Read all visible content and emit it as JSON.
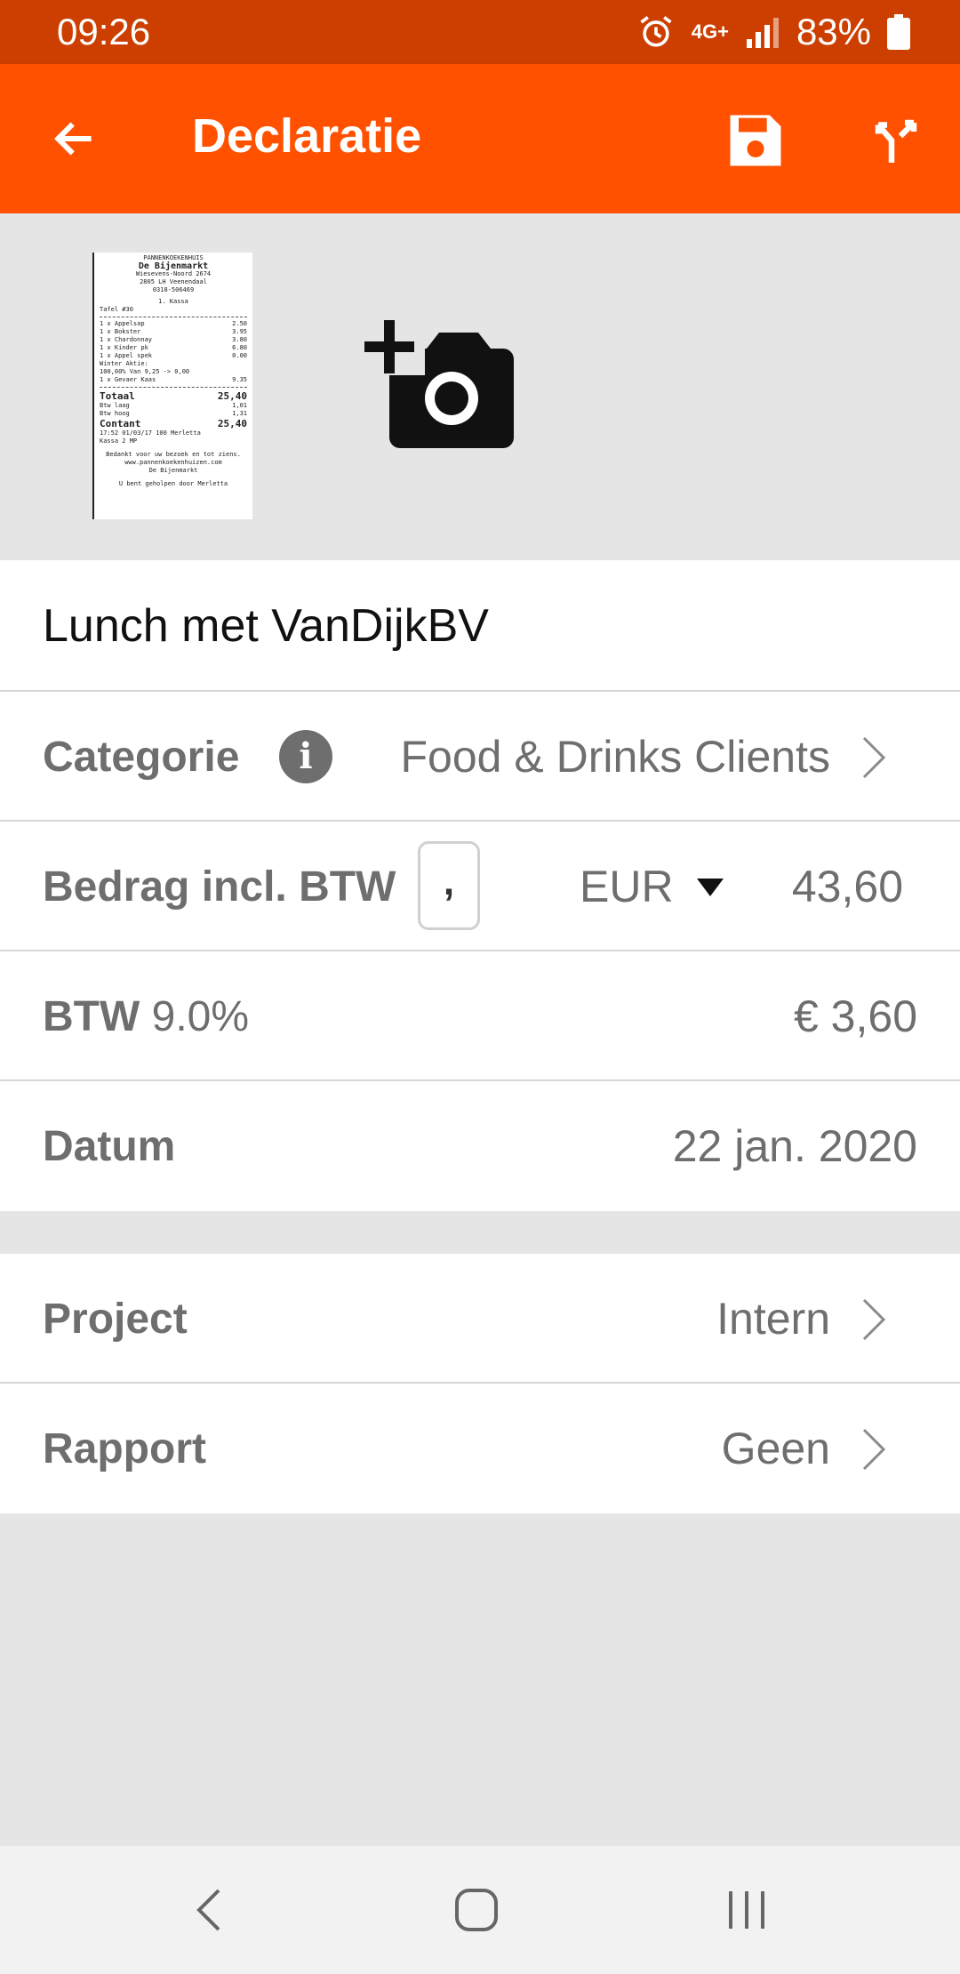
{
  "status": {
    "time": "09:26",
    "network": "4G+",
    "battery": "83%"
  },
  "appbar": {
    "title": "Declaratie"
  },
  "receipt": {
    "lines": [
      "PANNENKOEKENHUIS",
      "De Bijenmarkt",
      "Wiesevens-Noord 2674",
      "2805 LH Veenendaal",
      "0318-506469",
      "1. Kassa",
      "Tafel #30"
    ],
    "items": [
      [
        "1 x Appelsap",
        "2.50"
      ],
      [
        "1 x Bokster",
        "3.95"
      ],
      [
        "1 x Chardonnay",
        "3.80"
      ],
      [
        "1 x Kinder pk",
        "6.80"
      ],
      [
        "1 x Appel spek",
        "0.00"
      ],
      [
        "Winter Aktie:",
        ""
      ],
      [
        "100,00% Van 9,25 -> 0,00",
        ""
      ],
      [
        "1 x Gevaer Kaas",
        "9.35"
      ]
    ],
    "total_label": "Totaal",
    "total": "25,40",
    "sub": [
      [
        "Btw laag",
        "1,01"
      ],
      [
        "Btw hoog",
        "1,31"
      ]
    ],
    "cash_label": "Contant",
    "cash": "25,40",
    "footer": [
      "17:52 01/03/17 100 Merletta",
      "Kassa 2 MP",
      "Bedankt voor uw bezoek en tot ziens.",
      "www.pannenkoekenhuizen.com",
      "De Bijenmarkt",
      "U bent geholpen door Merletta"
    ]
  },
  "description": "Lunch met VanDijkBV",
  "category": {
    "label": "Categorie",
    "value": "Food & Drinks Clients"
  },
  "amount": {
    "label": "Bedrag incl. BTW",
    "comma": ",",
    "currency": "EUR",
    "value": "43,60"
  },
  "vat": {
    "label": "BTW",
    "rate": "9.0%",
    "value": "€ 3,60"
  },
  "date": {
    "label": "Datum",
    "value": "22 jan. 2020"
  },
  "project": {
    "label": "Project",
    "value": "Intern"
  },
  "report": {
    "label": "Rapport",
    "value": "Geen"
  }
}
